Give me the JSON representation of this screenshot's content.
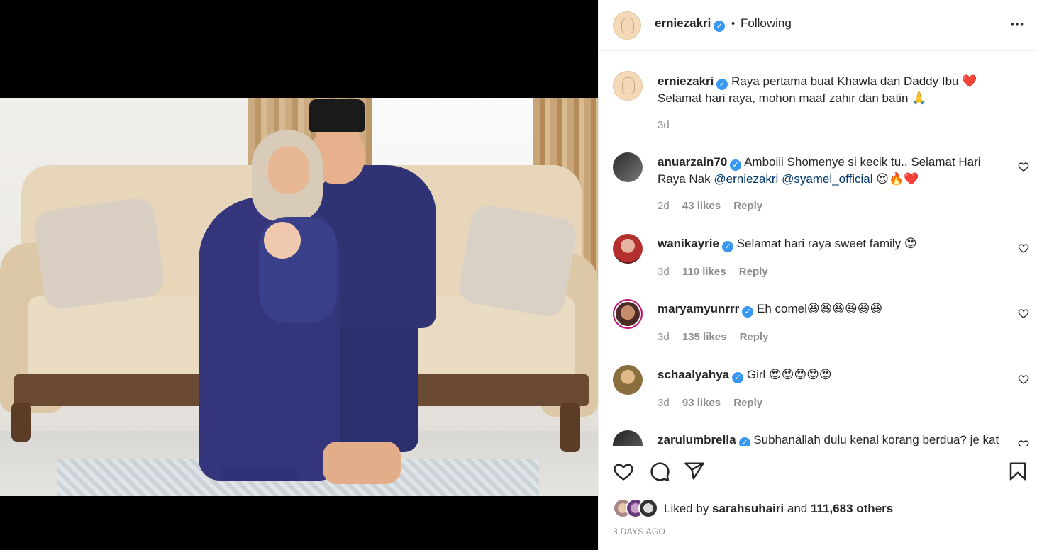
{
  "post": {
    "author": "erniezakri",
    "follow_dot": "•",
    "follow_status": "Following",
    "more_icon": "more-horizontal-icon"
  },
  "caption": {
    "username": "erniezakri",
    "text": "Raya pertama buat Khawla dan Daddy Ibu ❤️",
    "text_line2": "Selamat hari raya, mohon maaf zahir dan batin 🙏",
    "age": "3d"
  },
  "comments": [
    {
      "username": "anuarzain70",
      "text_before": "Amboiii Shomenye si kecik tu.. Selamat Hari Raya Nak ",
      "mention1": "@erniezakri",
      "mention2": "@syamel_official",
      "text_after": " 😍🔥❤️",
      "age": "2d",
      "likes": "43 likes",
      "reply": "Reply"
    },
    {
      "username": "wanikayrie",
      "text": "Selamat hari raya sweet family 😍",
      "age": "3d",
      "likes": "110 likes",
      "reply": "Reply"
    },
    {
      "username": "maryamyunrrr",
      "text": "Eh comel😆😆😆😆😆😆",
      "age": "3d",
      "likes": "135 likes",
      "reply": "Reply"
    },
    {
      "username": "schaalyahya",
      "text": "Girl 😍😍😍😍😍",
      "age": "3d",
      "likes": "93 likes",
      "reply": "Reply"
    },
    {
      "username": "zarulumbrella",
      "text": "Subhanallah dulu kenal korang berdua? je kat"
    }
  ],
  "liked_by": {
    "prefix": "Liked by ",
    "user": "sarahsuhairi",
    "suffix": " and ",
    "others": "111,683 others"
  },
  "date": "3 DAYS AGO",
  "colors": {
    "link": "#00376b",
    "verified": "#3897f0",
    "secondary_text": "#8e8e8e"
  }
}
